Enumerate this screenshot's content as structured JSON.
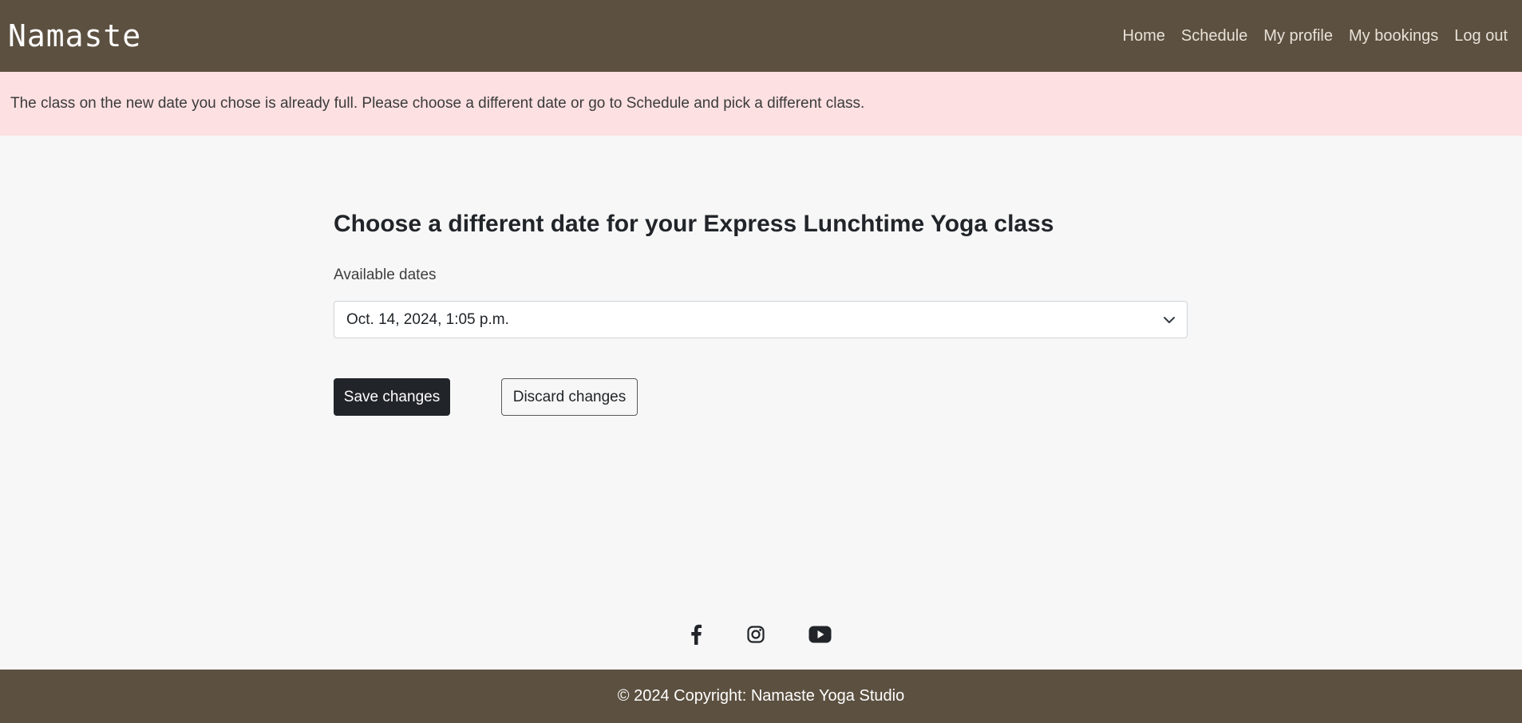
{
  "nav": {
    "brand": "Namaste",
    "links": [
      "Home",
      "Schedule",
      "My profile",
      "My bookings",
      "Log out"
    ]
  },
  "alert": {
    "message": "The class on the new date you chose is already full. Please choose a different date or go to Schedule and pick a different class."
  },
  "form": {
    "heading": "Choose a different date for your Express Lunchtime Yoga class",
    "dates_label": "Available dates",
    "selected_date": "Oct. 14, 2024, 1:05 p.m.",
    "save_label": "Save changes",
    "discard_label": "Discard changes"
  },
  "social": {
    "icons": [
      "facebook-icon",
      "instagram-icon",
      "youtube-icon"
    ]
  },
  "footer": {
    "copyright": "© 2024 Copyright: Namaste Yoga Studio"
  },
  "colors": {
    "nav_bg": "#5c5040",
    "alert_bg": "#fde0e2",
    "page_bg": "#f7f7f7",
    "primary_button": "#212529"
  }
}
